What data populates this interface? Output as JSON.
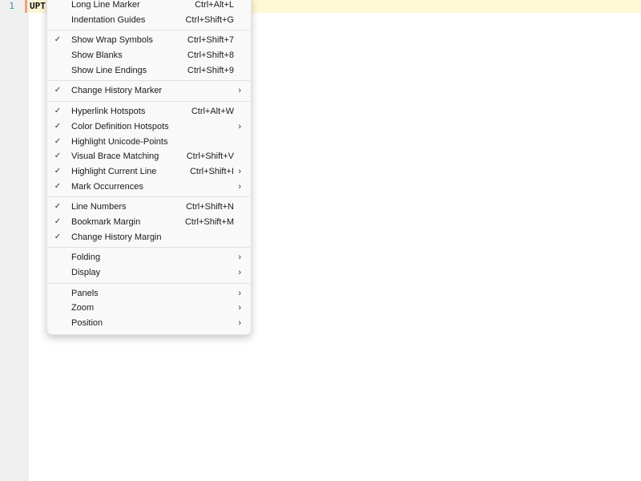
{
  "editor": {
    "line_number": "1",
    "text": "UPT"
  },
  "menu": {
    "groups": [
      [
        {
          "label": "Long Line Marker",
          "shortcut": "Ctrl+Alt+L",
          "checked": false,
          "submenu": false
        },
        {
          "label": "Indentation Guides",
          "shortcut": "Ctrl+Shift+G",
          "checked": false,
          "submenu": false
        }
      ],
      [
        {
          "label": "Show Wrap Symbols",
          "shortcut": "Ctrl+Shift+7",
          "checked": true,
          "submenu": false
        },
        {
          "label": "Show Blanks",
          "shortcut": "Ctrl+Shift+8",
          "checked": false,
          "submenu": false
        },
        {
          "label": "Show Line Endings",
          "shortcut": "Ctrl+Shift+9",
          "checked": false,
          "submenu": false
        }
      ],
      [
        {
          "label": "Change History Marker",
          "shortcut": "",
          "checked": true,
          "submenu": true
        }
      ],
      [
        {
          "label": "Hyperlink Hotspots",
          "shortcut": "Ctrl+Alt+W",
          "checked": true,
          "submenu": false
        },
        {
          "label": "Color Definition Hotspots",
          "shortcut": "",
          "checked": true,
          "submenu": true
        },
        {
          "label": "Highlight Unicode-Points",
          "shortcut": "",
          "checked": true,
          "submenu": false
        },
        {
          "label": "Visual Brace Matching",
          "shortcut": "Ctrl+Shift+V",
          "checked": true,
          "submenu": false
        },
        {
          "label": "Highlight Current Line",
          "shortcut": "Ctrl+Shift+I",
          "checked": true,
          "submenu": true
        },
        {
          "label": "Mark Occurrences",
          "shortcut": "",
          "checked": true,
          "submenu": true
        }
      ],
      [
        {
          "label": "Line Numbers",
          "shortcut": "Ctrl+Shift+N",
          "checked": true,
          "submenu": false
        },
        {
          "label": "Bookmark Margin",
          "shortcut": "Ctrl+Shift+M",
          "checked": true,
          "submenu": false
        },
        {
          "label": "Change History Margin",
          "shortcut": "",
          "checked": true,
          "submenu": false
        }
      ],
      [
        {
          "label": "Folding",
          "shortcut": "",
          "checked": false,
          "submenu": true
        },
        {
          "label": "Display",
          "shortcut": "",
          "checked": false,
          "submenu": true
        }
      ],
      [
        {
          "label": "Panels",
          "shortcut": "",
          "checked": false,
          "submenu": true
        },
        {
          "label": "Zoom",
          "shortcut": "",
          "checked": false,
          "submenu": true
        },
        {
          "label": "Position",
          "shortcut": "",
          "checked": false,
          "submenu": true
        }
      ]
    ]
  }
}
